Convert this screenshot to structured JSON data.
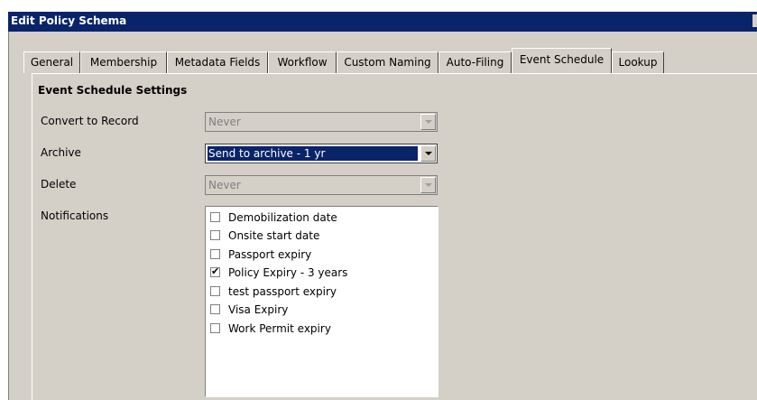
{
  "window": {
    "title": "Edit Policy Schema"
  },
  "tabs": [
    {
      "label": "General"
    },
    {
      "label": "Membership"
    },
    {
      "label": "Metadata Fields"
    },
    {
      "label": "Workflow"
    },
    {
      "label": "Custom Naming"
    },
    {
      "label": "Auto-Filing"
    },
    {
      "label": "Event Schedule"
    },
    {
      "label": "Lookup"
    }
  ],
  "active_tab": "Event Schedule",
  "section": {
    "title": "Event Schedule Settings"
  },
  "form": {
    "convert_to_record": {
      "label": "Convert to Record",
      "value": "Never",
      "enabled": false
    },
    "archive": {
      "label": "Archive",
      "value": "Send to archive - 1 yr",
      "enabled": true
    },
    "delete": {
      "label": "Delete",
      "value": "Never",
      "enabled": false
    },
    "notifications": {
      "label": "Notifications",
      "items": [
        {
          "label": "Demobilization date",
          "checked": false
        },
        {
          "label": "Onsite start date",
          "checked": false
        },
        {
          "label": "Passport expiry",
          "checked": false
        },
        {
          "label": "Policy Expiry - 3 years",
          "checked": true
        },
        {
          "label": "test passport expiry",
          "checked": false
        },
        {
          "label": "Visa Expiry",
          "checked": false
        },
        {
          "label": "Work Permit expiry",
          "checked": false
        }
      ]
    }
  },
  "icons": {
    "check": "✔"
  },
  "colors": {
    "titlebar": "#0a246a",
    "dialog_bg": "#d4d0c8",
    "selection": "#0a246a"
  }
}
